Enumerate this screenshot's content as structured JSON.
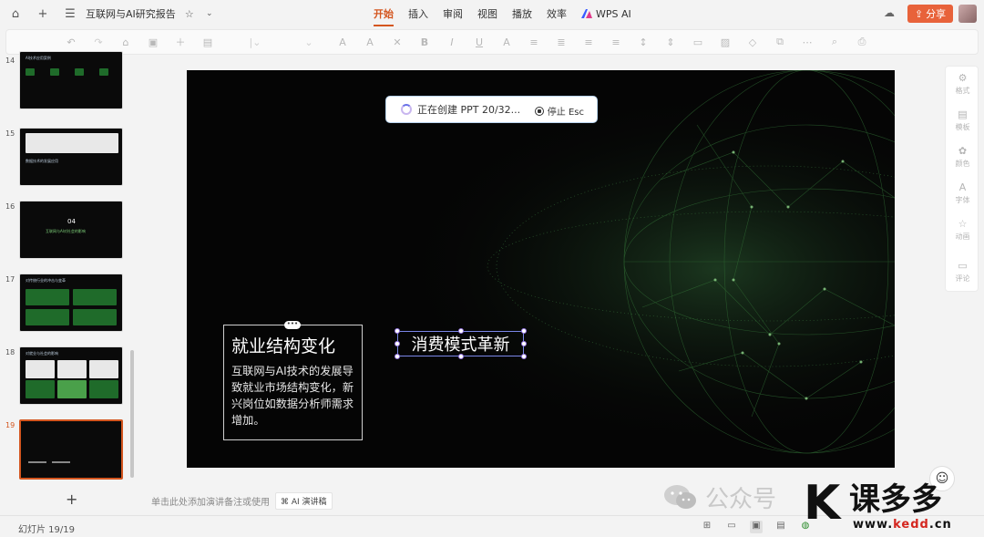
{
  "titlebar": {
    "title": "互联网与AI研究报告",
    "menu": [
      "开始",
      "插入",
      "审阅",
      "视图",
      "播放",
      "效率"
    ],
    "active_menu": "开始",
    "wps_ai": "WPS AI",
    "share": "分享",
    "accent": "#d4561f",
    "share_color": "#e8623a"
  },
  "thumbnails": [
    {
      "num": "14",
      "heading": "AI技术应用案例"
    },
    {
      "num": "15",
      "heading": "数据技术的发展应用"
    },
    {
      "num": "16",
      "num_big": "04",
      "heading": "互联网与AI对社会的影响"
    },
    {
      "num": "17",
      "heading": "对传统行业的冲击与变革"
    },
    {
      "num": "18",
      "heading": "对就业与社会的影响"
    },
    {
      "num": "19",
      "heading": "",
      "active": true
    }
  ],
  "slide": {
    "status": "正在创建 PPT 20/32...",
    "stop": "停止 Esc",
    "box1_title": "就业结构变化",
    "box1_body": "互联网与AI技术的发展导致就业市场结构变化，新兴岗位如数据分析师需求增加。",
    "box2_title": "消费模式革新"
  },
  "side_panel": [
    "格式",
    "模板",
    "颜色",
    "字体",
    "动画",
    "评论"
  ],
  "notes": {
    "placeholder": "单击此处添加演讲备注或使用",
    "ai_button": "AI 演讲稿"
  },
  "statusbar": {
    "slide_count": "幻灯片 19/19"
  },
  "watermark": {
    "account": "公众号",
    "brand": "课多多",
    "url_prefix": "www.",
    "url_main": "kedd",
    "url_suffix": ".cn"
  }
}
